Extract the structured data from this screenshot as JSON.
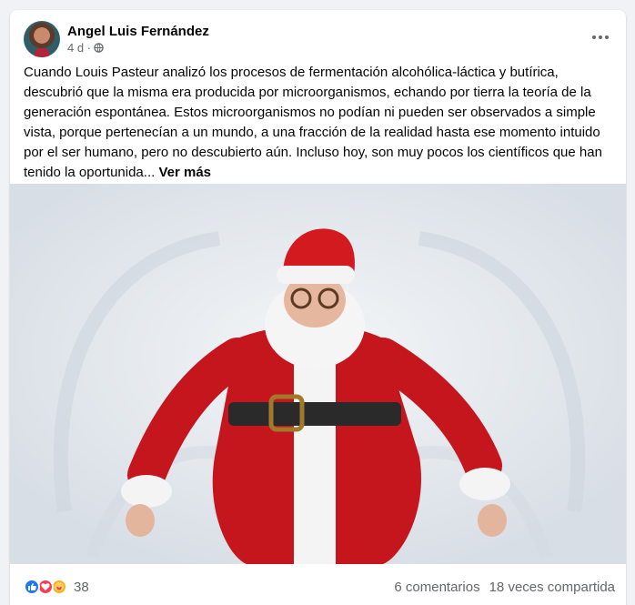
{
  "post": {
    "author": "Angel Luis Fernández",
    "time": "4 d ·",
    "text": "Cuando Louis Pasteur analizó los procesos de fermentación alcohólica-láctica y butírica, descubrió que la misma era producida por microorganismos, echando por tierra la teoría de la generación espontánea. Estos microorganismos no podían ni pueden ser observados a simple vista, porque pertenecían a un mundo, a una fracción de la realidad hasta ese momento intuido por el ser humano, pero no descubierto aún. Incluso hoy, son muy pocos los científicos que han tenido la oportunida...",
    "see_more": "Ver más"
  },
  "footer": {
    "reaction_count": "38",
    "comments": "6 comentarios",
    "shares": "18 veces compartida"
  },
  "icons": {
    "privacy": "globe-icon",
    "menu": "more-horizontal-icon",
    "reactions": [
      "like-icon",
      "love-icon",
      "care-icon"
    ]
  },
  "colors": {
    "like": "#1877f2",
    "love": "#f33e58",
    "care": "#f7b125",
    "secondary_text": "#65676b"
  }
}
